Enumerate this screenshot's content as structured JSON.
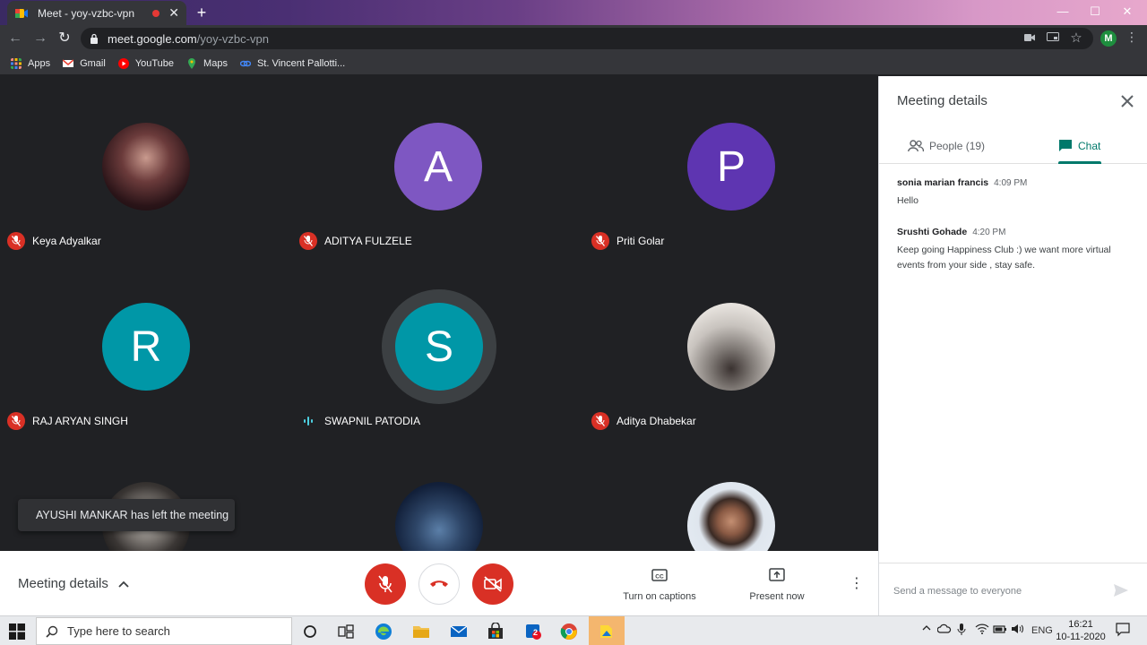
{
  "browser": {
    "tab_title": "Meet - yoy-vzbc-vpn",
    "tab_close": "✕",
    "new_tab": "+",
    "url_host": "meet.google.com",
    "url_path": "/yoy-vzbc-vpn",
    "profile_initial": "M",
    "window_min": "—",
    "window_max": "☐",
    "window_close": "✕"
  },
  "bookmarks": [
    {
      "label": "Apps",
      "icon": "apps-grid-icon",
      "color": "#f28b82"
    },
    {
      "label": "Gmail",
      "icon": "gmail-icon",
      "color": "#ea4335"
    },
    {
      "label": "YouTube",
      "icon": "youtube-icon",
      "color": "#ff0000"
    },
    {
      "label": "Maps",
      "icon": "maps-icon",
      "color": "#34a853"
    },
    {
      "label": "St. Vincent Pallotti...",
      "icon": "link-icon",
      "color": "#4285f4"
    }
  ],
  "participants": [
    {
      "name": "Keya Adyalkar",
      "avatar": "photo",
      "muted": true
    },
    {
      "name": "ADITYA FULZELE",
      "avatar": "A",
      "color": "#7e57c2",
      "muted": true
    },
    {
      "name": "Priti Golar",
      "avatar": "P",
      "color": "#5e35b1",
      "muted": true
    },
    {
      "name": "RAJ ARYAN SINGH",
      "avatar": "R",
      "color": "#0097a7",
      "muted": true
    },
    {
      "name": "SWAPNIL PATODIA",
      "avatar": "S",
      "color": "#0097a7",
      "muted": false,
      "speaking": true
    },
    {
      "name": "Aditya Dhabekar",
      "avatar": "photo",
      "muted": true
    },
    {
      "name": "",
      "avatar": "photo"
    },
    {
      "name": "",
      "avatar": "photo"
    },
    {
      "name": "",
      "avatar": "photo"
    }
  ],
  "toast": "AYUSHI MANKAR has left the meeting",
  "panel": {
    "title": "Meeting details",
    "tabs": {
      "people": "People (19)",
      "chat": "Chat"
    },
    "messages": [
      {
        "sender": "sonia marian francis",
        "time": "4:09 PM",
        "text": "Hello"
      },
      {
        "sender": "Srushti Gohade",
        "time": "4:20 PM",
        "text": "Keep going Happiness Club :) we want more virtual events from your side , stay safe."
      }
    ],
    "input_placeholder": "Send a message to everyone"
  },
  "bottombar": {
    "meeting_details": "Meeting details",
    "captions": "Turn on captions",
    "present": "Present now",
    "more": "⋮"
  },
  "taskbar": {
    "search_placeholder": "Type here to search",
    "lang": "ENG",
    "time": "16:21",
    "date": "10-11-2020",
    "store_badge": "2"
  }
}
